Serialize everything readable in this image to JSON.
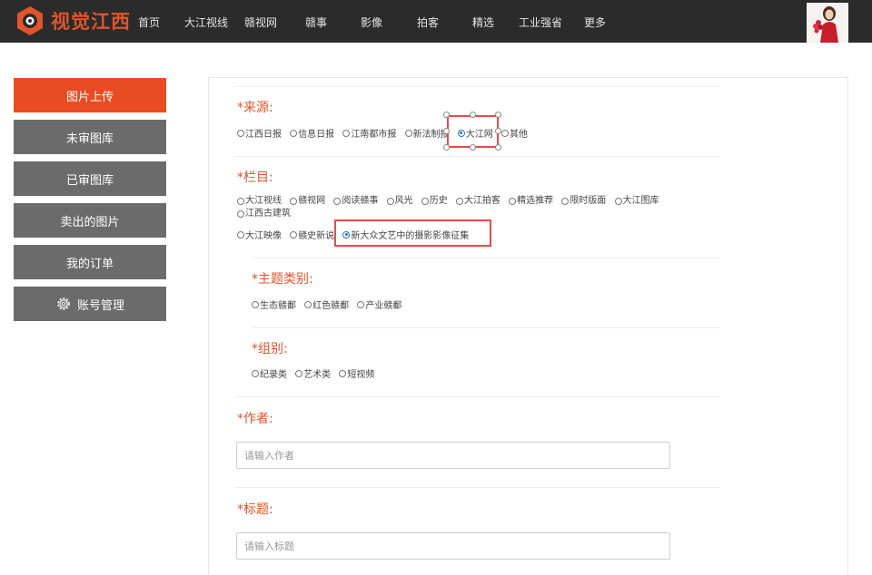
{
  "header": {
    "logo_text": "视觉江西",
    "nav": [
      "首页",
      "大江视线",
      "赣视网",
      "赣事",
      "影像",
      "拍客",
      "精选",
      "工业强省",
      "更多"
    ]
  },
  "sidebar": {
    "items": [
      {
        "label": "图片上传",
        "active": true
      },
      {
        "label": "未审图库",
        "active": false
      },
      {
        "label": "已审图库",
        "active": false
      },
      {
        "label": "卖出的图片",
        "active": false
      },
      {
        "label": "我的订单",
        "active": false
      },
      {
        "label": "账号管理",
        "active": false
      }
    ]
  },
  "form": {
    "source": {
      "label": "*来源:",
      "options": [
        "江西日报",
        "信息日报",
        "江南都市报",
        "新法制报",
        "大江网",
        "其他"
      ],
      "selected": "大江网"
    },
    "column": {
      "label": "*栏目:",
      "options_row1": [
        "大江视线",
        "赣视网",
        "阅读赣事",
        "风光",
        "历史",
        "大江拍客",
        "精选推荐",
        "限时版面",
        "大江图库",
        "江西古建筑"
      ],
      "options_row2": [
        "大江映像",
        "赣史新说",
        "新大众文艺中的摄影影像征集"
      ],
      "selected": "新大众文艺中的摄影影像征集"
    },
    "theme": {
      "label": "*主题类别:",
      "options": [
        "生态赣鄱",
        "红色赣鄱",
        "产业赣鄱"
      ]
    },
    "group": {
      "label": "*组别:",
      "options": [
        "纪录类",
        "艺术类",
        "短视频"
      ]
    },
    "author": {
      "label": "*作者:",
      "placeholder": "请输入作者"
    },
    "title": {
      "label": "*标题:",
      "placeholder": "请输入标题"
    }
  },
  "colors": {
    "accent": "#e84c22",
    "topbar": "#2b2b2b",
    "sidebar": "#6b6b6b",
    "highlight": "#e84a4a",
    "radio_selected": "#2f6fd6"
  }
}
